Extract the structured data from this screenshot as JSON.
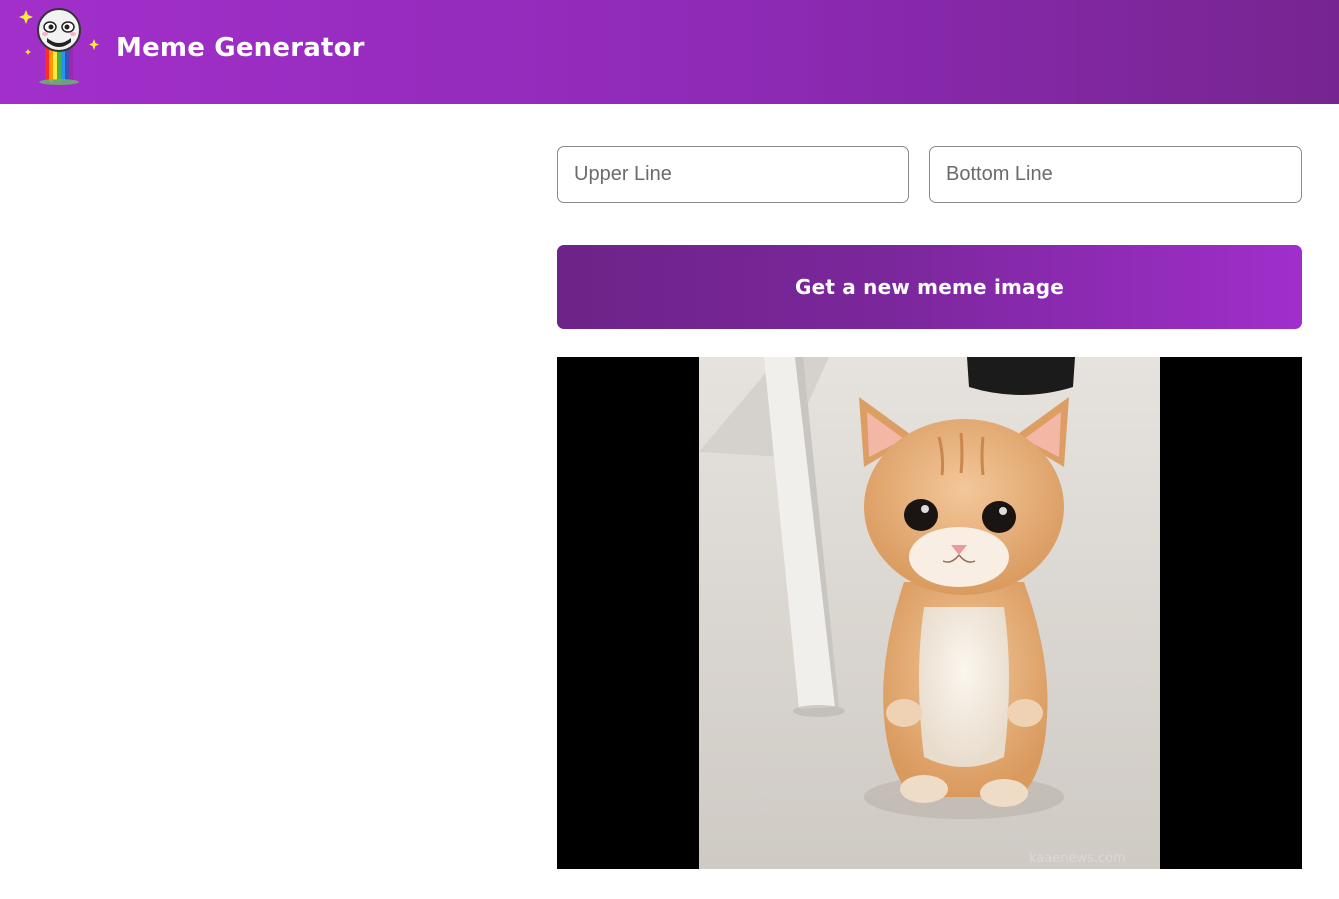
{
  "header": {
    "title": "Meme Generator",
    "logo_icon": "rainbow-face-logo-icon"
  },
  "form": {
    "upper_placeholder": "Upper Line",
    "bottom_placeholder": "Bottom Line",
    "upper_value": "",
    "bottom_value": ""
  },
  "button": {
    "label": "Get a new meme image"
  },
  "meme": {
    "image_alt": "Kitten standing on hind legs",
    "watermark": "kaaenews.com"
  },
  "colors": {
    "brand_start": "#a22fcb",
    "brand_end": "#762590",
    "button_start": "#6d2388",
    "button_end": "#a02ecb"
  }
}
